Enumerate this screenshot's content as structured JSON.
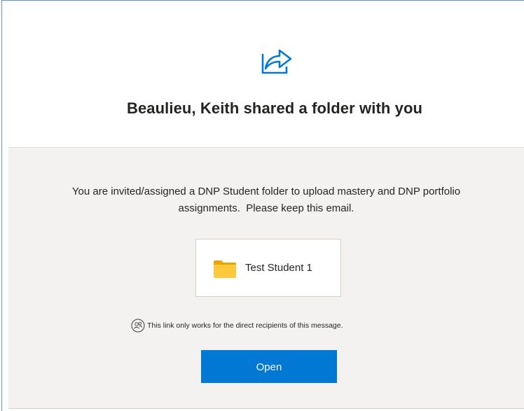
{
  "header": {
    "icon": "share-arrow-icon",
    "title": "Beaulieu, Keith shared a folder with you"
  },
  "body": {
    "message_line1": "You are invited/assigned a DNP Student folder to upload mastery and DNP portfolio",
    "message_line2": "assignments.  Please keep this email.",
    "folder": {
      "icon": "folder-icon",
      "name": "Test Student 1"
    },
    "notice": {
      "icon": "people-icon",
      "text": "This link only works for the direct recipients of this message."
    },
    "open_button_label": "Open"
  },
  "colors": {
    "accent": "#0078d4",
    "header_bg": "#ffffff",
    "body_bg": "#f3f2f1",
    "folder_yellow": "#ffc83d",
    "frame_border": "#5b8fd6"
  }
}
